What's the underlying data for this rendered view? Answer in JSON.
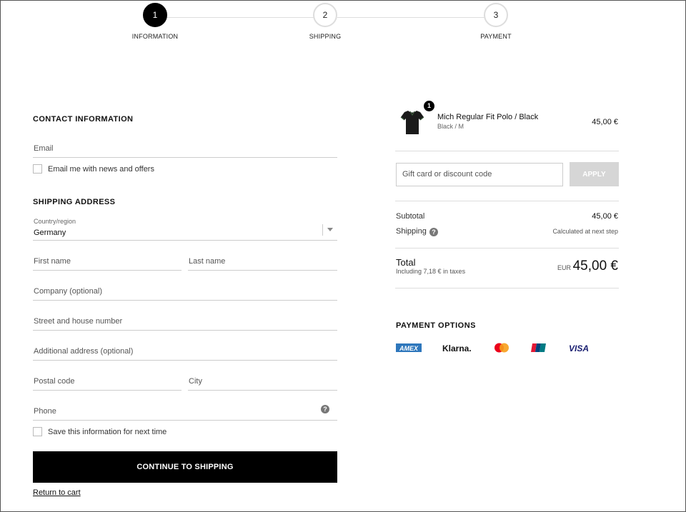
{
  "steps": [
    {
      "number": "1",
      "label": "INFORMATION"
    },
    {
      "number": "2",
      "label": "SHIPPING"
    },
    {
      "number": "3",
      "label": "PAYMENT"
    }
  ],
  "contact": {
    "title": "CONTACT INFORMATION",
    "email_placeholder": "Email",
    "newsletter_label": "Email me with news and offers"
  },
  "shipping": {
    "title": "SHIPPING ADDRESS",
    "country_label": "Country/region",
    "country_value": "Germany",
    "first_name": "First name",
    "last_name": "Last name",
    "company": "Company (optional)",
    "street": "Street and house number",
    "additional": "Additional address (optional)",
    "postal": "Postal code",
    "city": "City",
    "phone": "Phone",
    "save_info_label": "Save this information for next time"
  },
  "actions": {
    "continue_label": "CONTINUE TO SHIPPING",
    "return_label": "Return to cart"
  },
  "summary": {
    "product": {
      "qty": "1",
      "name": "Mich Regular Fit Polo / Black",
      "variant": "Black / M",
      "price": "45,00 €"
    },
    "discount_placeholder": "Gift card or discount code",
    "apply_label": "APPLY",
    "subtotal_label": "Subtotal",
    "subtotal_value": "45,00 €",
    "shipping_label": "Shipping",
    "shipping_value": "Calculated at next step",
    "total_label": "Total",
    "tax_note": "Including 7,18 € in taxes",
    "currency": "EUR",
    "total_value": "45,00 €"
  },
  "payment": {
    "title": "PAYMENT OPTIONS",
    "icons": [
      "amex-icon",
      "klarna-icon",
      "mastercard-icon",
      "unionpay-icon",
      "visa-icon"
    ],
    "amex_text": "AMEX",
    "klarna_text": "Klarna.",
    "visa_text": "VISA"
  },
  "colors": {
    "primary": "#000000",
    "apply_disabled": "#d6d6d6",
    "amex": "#2e77bc",
    "visa": "#1a1f71",
    "mastercard_red": "#eb001b",
    "mastercard_orange": "#f79e1b"
  }
}
